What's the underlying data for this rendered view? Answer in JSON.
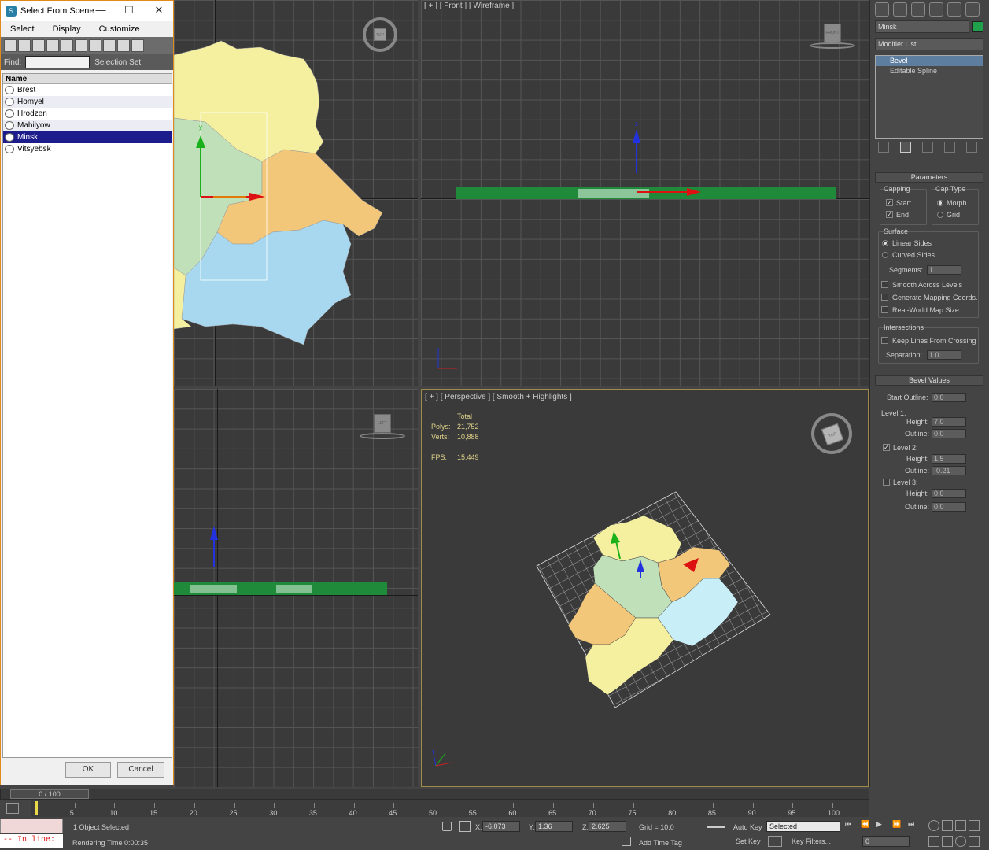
{
  "dialog": {
    "title": "Select From Scene",
    "menu": [
      "Select",
      "Display",
      "Customize"
    ],
    "find_label": "Find:",
    "selection_set_label": "Selection Set:",
    "column_name": "Name",
    "items": [
      "Brest",
      "Homyel",
      "Hrodzen",
      "Mahilyow",
      "Minsk",
      "Vitsyebsk"
    ],
    "selected_item": "Minsk",
    "ok": "OK",
    "cancel": "Cancel"
  },
  "viewports": {
    "top_cube": "TOP",
    "front_label": "[ + ] [ Front ] [ Wireframe ]",
    "front_cube": "FRONT",
    "left_cube": "LEFT",
    "persp_label": "[ + ] [ Perspective ] [ Smooth + Highlights ]",
    "persp_cube": "TOP",
    "stats": {
      "total_label": "Total",
      "polys_label": "Polys:",
      "polys": "21,752",
      "verts_label": "Verts:",
      "verts": "10,888",
      "fps_label": "FPS:",
      "fps": "15.449"
    },
    "axis": {
      "x": "x",
      "y": "y",
      "z": "z"
    }
  },
  "panel": {
    "object_name": "Minsk",
    "object_color": "#1fa04a",
    "modifier_list": "Modifier List",
    "stack": [
      "Bevel",
      "Editable Spline"
    ],
    "parameters": "Parameters",
    "capping": "Capping",
    "start": "Start",
    "end": "End",
    "cap_type": "Cap Type",
    "morph": "Morph",
    "grid": "Grid",
    "surface": "Surface",
    "linear_sides": "Linear Sides",
    "curved_sides": "Curved Sides",
    "segments_label": "Segments:",
    "segments": "1",
    "smooth_across": "Smooth Across Levels",
    "gen_mapping": "Generate Mapping Coords.",
    "real_world": "Real-World Map Size",
    "intersections": "Intersections",
    "keep_lines": "Keep Lines From Crossing",
    "separation_label": "Separation:",
    "separation": "1.0",
    "bevel_values": "Bevel Values",
    "start_outline_label": "Start Outline:",
    "start_outline": "0.0",
    "level1": "Level 1:",
    "height_label": "Height:",
    "outline_label": "Outline:",
    "l1_height": "7.0",
    "l1_outline": "0.0",
    "level2": "Level 2:",
    "l2_height": "1.5",
    "l2_outline": "-0.21",
    "level3": "Level 3:",
    "l3_height": "0.0",
    "l3_outline": "0.0"
  },
  "timeline": {
    "frame_label": "0 / 100",
    "ticks": [
      "5",
      "10",
      "15",
      "20",
      "25",
      "30",
      "35",
      "40",
      "45",
      "50",
      "55",
      "60",
      "65",
      "70",
      "75",
      "80",
      "85",
      "90",
      "95",
      "100"
    ]
  },
  "status": {
    "script": "-- In line:",
    "selected": "1 Object Selected",
    "render_time": "Rendering Time  0:00:35",
    "x_label": "X:",
    "x": "-6.073",
    "y_label": "Y:",
    "y": "1.36",
    "z_label": "Z:",
    "z": "2.625",
    "grid": "Grid = 10.0",
    "add_time_tag": "Add Time Tag",
    "auto_key": "Auto Key",
    "set_key": "Set Key",
    "selected_dd": "Selected",
    "key_filters": "Key Filters...",
    "frame": "0"
  },
  "colors": {
    "yellow": "#f5f0a0",
    "green": "#bfe0b8",
    "orange": "#f3c77a",
    "blue": "#a8d8ef",
    "extrude_green": "#1e8a3a"
  }
}
